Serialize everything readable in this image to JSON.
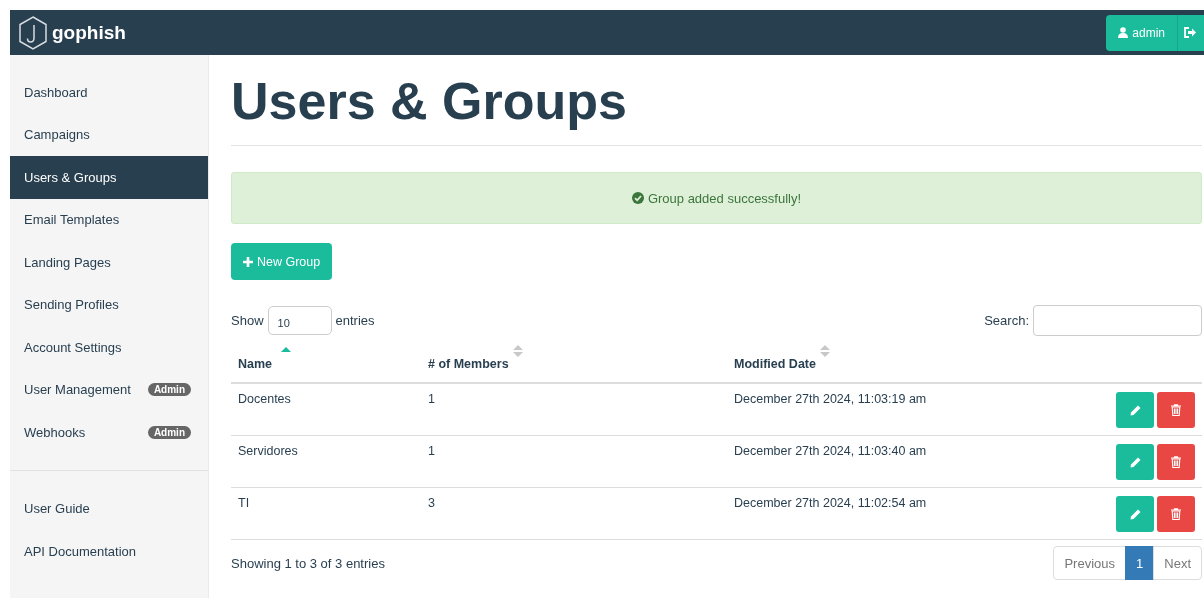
{
  "navbar": {
    "brand": "gophish",
    "user_button": "admin"
  },
  "sidebar": {
    "items": [
      {
        "label": "Dashboard",
        "selected": false
      },
      {
        "label": "Campaigns",
        "selected": false
      },
      {
        "label": "Users & Groups",
        "selected": true
      },
      {
        "label": "Email Templates",
        "selected": false
      },
      {
        "label": "Landing Pages",
        "selected": false
      },
      {
        "label": "Sending Profiles",
        "selected": false
      },
      {
        "label": "Account Settings",
        "selected": false
      },
      {
        "label": "User Management",
        "selected": false,
        "badge": "Admin"
      },
      {
        "label": "Webhooks",
        "selected": false,
        "badge": "Admin"
      }
    ],
    "footer_items": [
      {
        "label": "User Guide",
        "selected": false
      },
      {
        "label": "API Documentation",
        "selected": false
      }
    ]
  },
  "page_title": "Users & Groups",
  "alert": {
    "message": "Group added successfully!"
  },
  "new_group_button": "New Group",
  "table_controls": {
    "show_label": "Show",
    "page_size": "10",
    "entries_label": "entries",
    "search_label": "Search:"
  },
  "table": {
    "columns": [
      {
        "label": "Name",
        "sorted": true
      },
      {
        "label": "# of Members",
        "sorted": false
      },
      {
        "label": "Modified Date",
        "sorted": false
      }
    ],
    "rows": [
      {
        "name": "Docentes",
        "members": "1",
        "modified": "December 27th 2024, 11:03:19 am"
      },
      {
        "name": "Servidores",
        "members": "1",
        "modified": "December 27th 2024, 11:03:40 am"
      },
      {
        "name": "TI",
        "members": "3",
        "modified": "December 27th 2024, 11:02:54 am"
      }
    ]
  },
  "footer": {
    "info": "Showing 1 to 3 of 3 entries",
    "pagination": [
      {
        "label": "Previous",
        "kind": "prev",
        "selected": false
      },
      {
        "label": "1",
        "kind": "page",
        "selected": true
      },
      {
        "label": "Next",
        "kind": "next",
        "selected": false
      }
    ]
  }
}
